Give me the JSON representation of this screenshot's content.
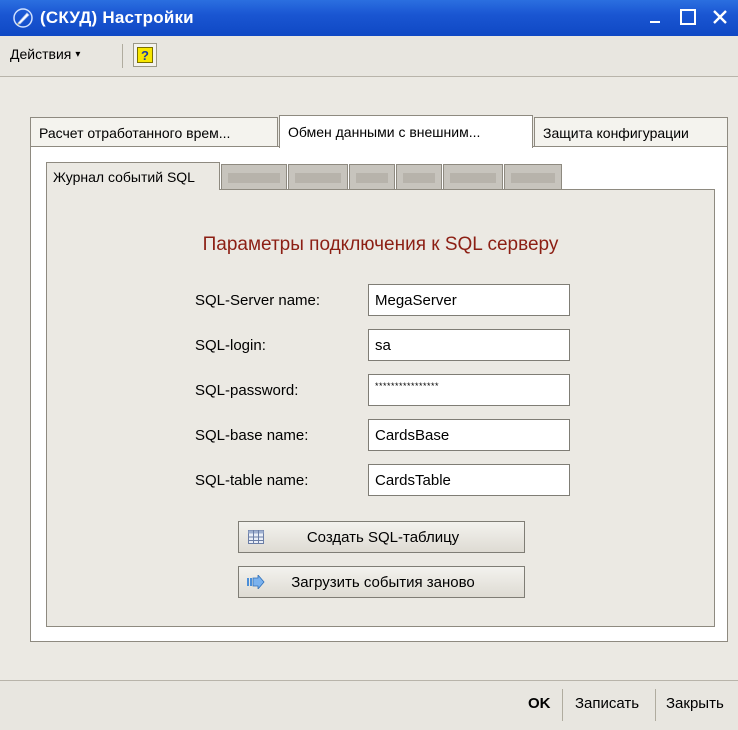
{
  "window": {
    "title": "(СКУД) Настройки",
    "minimize_glyph": "_",
    "maximize_glyph": "□",
    "close_glyph": "✕"
  },
  "toolbar": {
    "actions_label": "Действия",
    "actions_arrow": "▾",
    "help_label": "?"
  },
  "outer_tabs": [
    {
      "label": "Расчет отработанного врем..."
    },
    {
      "label": "Обмен данными с внешним..."
    },
    {
      "label": "Защита конфигурации"
    }
  ],
  "inner_tabs": [
    {
      "label": "Журнал событий SQL"
    }
  ],
  "form": {
    "heading": "Параметры подключения к SQL серверу",
    "fields": [
      {
        "label": "SQL-Server name:",
        "value": "MegaServer"
      },
      {
        "label": "SQL-login:",
        "value": "sa"
      },
      {
        "label": "SQL-password:",
        "value": "****************"
      },
      {
        "label": "SQL-base name:",
        "value": "CardsBase"
      },
      {
        "label": "SQL-table name:",
        "value": "CardsTable"
      }
    ]
  },
  "buttons": {
    "create_table": "Создать SQL-таблицу",
    "reload_events": "Загрузить события заново"
  },
  "bottom": {
    "ok": "OK",
    "save": "Записать",
    "close": "Закрыть"
  },
  "colors": {
    "titlebar": "#1a56d2",
    "heading": "#8c1f14",
    "panel": "#ebe9e3"
  }
}
